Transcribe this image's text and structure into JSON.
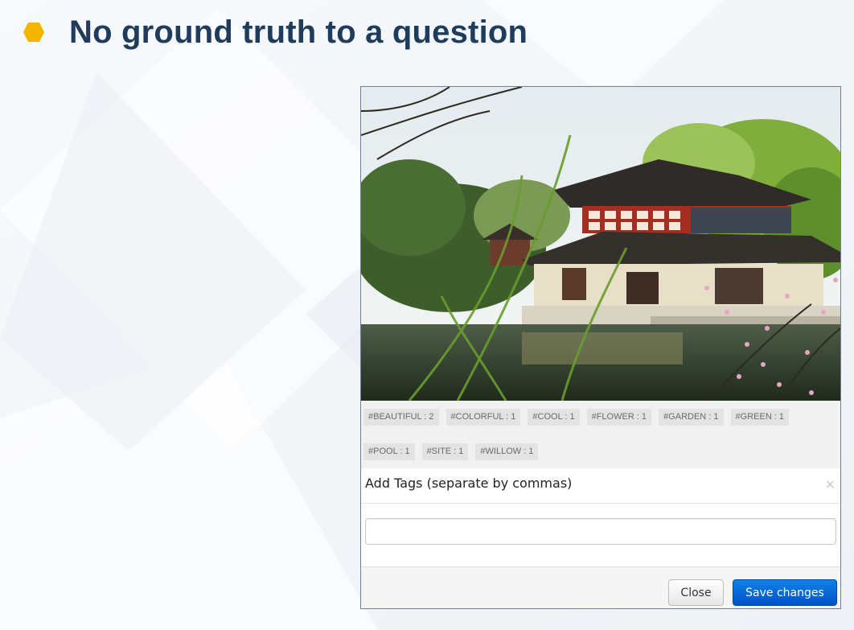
{
  "slide": {
    "title": "No ground truth to a question"
  },
  "colors": {
    "title": "#1f3c5c",
    "bullet": "#f5b400",
    "primary_button": "#0a6ad8",
    "tag_background": "#e3e3e3"
  },
  "image": {
    "icon": "photo-icon",
    "subject": "garden-pavilion-photo"
  },
  "tags": [
    "#BEAUTIFUL : 2",
    "#COLORFUL : 1",
    "#COOL : 1",
    "#FLOWER : 1",
    "#GARDEN : 1",
    "#GREEN : 1",
    "#POOL : 1",
    "#SITE : 1",
    "#WILLOW : 1"
  ],
  "modal": {
    "title": "Add Tags (separate by commas)",
    "close_icon_glyph": "×",
    "input_value": "",
    "input_placeholder": "",
    "close_button": "Close",
    "save_button": "Save changes"
  }
}
